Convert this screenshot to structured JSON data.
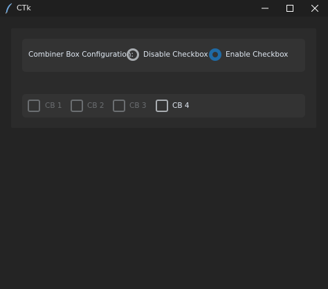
{
  "window": {
    "title": "CTk",
    "icon": "feather-pen-icon"
  },
  "config": {
    "label": "Combiner Box Configuration:",
    "options": [
      {
        "label": "Disable Checkbox",
        "selected": false
      },
      {
        "label": "Enable Checkbox",
        "selected": true
      }
    ]
  },
  "checkboxes": [
    {
      "label": "CB 1",
      "checked": false,
      "enabled": false
    },
    {
      "label": "CB 2",
      "checked": false,
      "enabled": false
    },
    {
      "label": "CB 3",
      "checked": false,
      "enabled": false
    },
    {
      "label": "CB 4",
      "checked": false,
      "enabled": true
    }
  ],
  "colors": {
    "accent": "#1f6aa5",
    "background": "#242424",
    "frame": "#2b2b2b",
    "inner_frame": "#333333",
    "text": "#dce4ee",
    "disabled_text": "#6b6e71"
  }
}
